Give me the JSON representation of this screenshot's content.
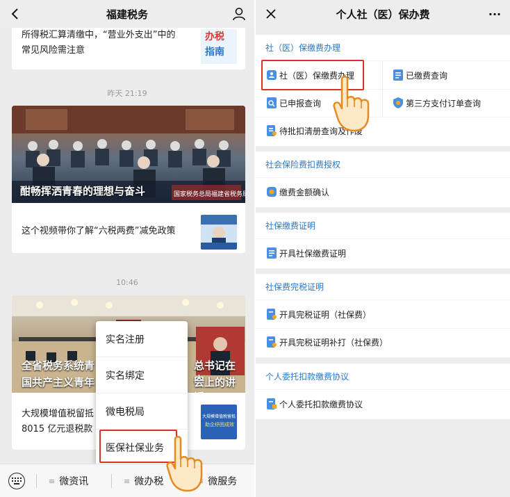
{
  "left": {
    "title": "福建税务",
    "first_card_text_1": "所得税汇算清缴中，“营业外支出”中的",
    "first_card_text_2": "常见风险需注意",
    "first_card_thumb_line1": "办税",
    "first_card_thumb_line2": "指南",
    "timestamp_1": "昨天 21:19",
    "banner_1_title": "酣畅挥洒青春的理想与奋斗",
    "banner_1_sign": "国家税务总局福建省税务局",
    "article_2": "这个视频带你了解“六税两费”减免政策",
    "timestamp_2": "10:46",
    "banner_2_line1_left": "全省税务系统青",
    "banner_2_line1_right": "总书记在中",
    "banner_2_line2_left": "国共产主义青年",
    "banner_2_line2_right": "会上的讲话",
    "article_3_line1": "大规模增值税留抵",
    "article_3_line2": "8015 亿元退税款",
    "article_3_thumb_1": "大规模增值税留抵",
    "article_3_thumb_2": "助企纾困成效",
    "popup": [
      "实名注册",
      "实名绑定",
      "微电税局",
      "医保社保业务"
    ],
    "bottom": [
      "微资讯",
      "微办税",
      "微服务"
    ]
  },
  "right": {
    "title": "个人社（医）保办费",
    "more": "···",
    "sections": [
      {
        "header": "社（医）保缴费办理",
        "items": [
          "社（医）保缴费办理",
          "已缴费查询",
          "已申报查询",
          "第三方支付订单查询",
          "待批扣清册查询及作废"
        ]
      },
      {
        "header": "社会保险费扣费授权",
        "items": [
          "缴费金额确认"
        ]
      },
      {
        "header": "社保缴费证明",
        "items": [
          "开具社保缴费证明"
        ]
      },
      {
        "header": "社保费完税证明",
        "items": [
          "开具完税证明（社保费）",
          "开具完税证明补打（社保费）"
        ]
      },
      {
        "header": "个人委托扣款缴费协议",
        "items": [
          "个人委托扣款缴费协议"
        ]
      }
    ]
  },
  "colors": {
    "accent": "#2a78c7",
    "highlight": "#d9302a",
    "doc_icon": "#4a90e2",
    "orange": "#f5a623"
  }
}
